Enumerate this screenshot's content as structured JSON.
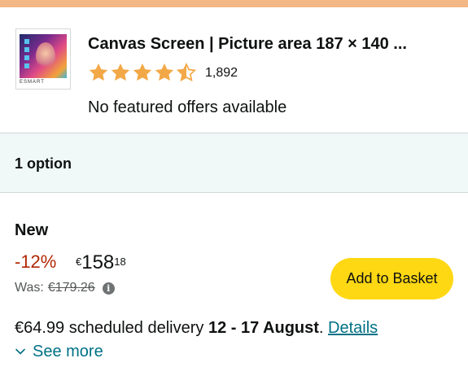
{
  "product": {
    "title": "Canvas Screen | Picture area 187 × 140 ...",
    "thumbnail_brand": "ESMART",
    "rating": 4.5,
    "rating_count": "1,892",
    "offers_note": "No featured offers available"
  },
  "options": {
    "label": "1 option"
  },
  "offer": {
    "condition": "New",
    "discount": "-12%",
    "price_symbol": "€",
    "price_whole": "158",
    "price_fraction": "18",
    "was_label": "Was:",
    "was_price": "€179.26",
    "info_glyph": "i",
    "add_to_basket": "Add to Basket",
    "delivery_price": "€64.99",
    "delivery_text": " scheduled delivery ",
    "delivery_dates": "12 - 17 August",
    "delivery_period": ". ",
    "details_link": "Details",
    "see_more": "See more"
  },
  "colors": {
    "top_bar": "#f2b784",
    "star": "#f3a847",
    "discount": "#b12704",
    "link": "#007185",
    "button": "#ffd814",
    "options_bg": "#f0f8f8"
  },
  "icons": {
    "stars": [
      "star-full-icon",
      "star-full-icon",
      "star-full-icon",
      "star-full-icon",
      "star-half-icon"
    ],
    "info": "info-icon",
    "see_more": "chevron-down-icon"
  }
}
